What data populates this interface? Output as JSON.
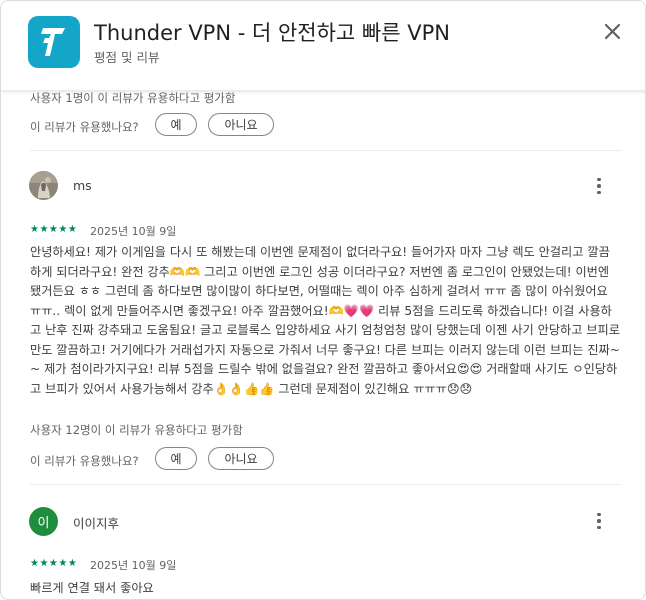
{
  "header": {
    "app_title": "Thunder VPN - 더 안전하고 빠른 VPN",
    "subtitle": "평점 및 리뷰",
    "icon": "thunder-vpn-logo",
    "icon_color": "#14a6c8"
  },
  "prev_review": {
    "helpful_count": "사용자 1명이 이 리뷰가 유용하다고 평가함",
    "helpful_question": "이 리뷰가 유용했나요?",
    "yes_label": "예",
    "no_label": "아니요"
  },
  "reviews": [
    {
      "author": "ms",
      "avatar": "photo-avatar",
      "stars": "★★★★★",
      "date": "2025년 10월 9일",
      "text": "안녕하세요! 제가 이게임을 다시 또 해봤는데 이번엔 문제점이 없더라구요! 들어가자 마자 그냥 렉도 안걸리고 깔끔하게 되더라구요! 완전 강추🫶🫶 그리고 이번엔 로그인 성공 이더라구요? 저번엔 좀 로그인이 안됐었는데! 이번엔 됐거든요 ㅎㅎ 그런데 좀 하다보면 많이많이 하다보면, 어떨때는 렉이 아주 심하게 걸려서 ㅠㅠ 좀 많이 아쉬웠어요 ㅠㅠ.. 렉이 없게 만들어주시면 좋겠구요! 아주 깔끔했어요!🫶💗💗 리뷰 5점을 드리도록 하겠습니다! 이걸 사용하고 난후 진짜 강추돼고 도움됨요! 글고 로블록스 입양하세요 사기 엄청엄청 많이 당했는데 이젠 사기 안당하고 브피로만도 깔끔하고! 거기에다가 거래섭가지 자동으로 가줘서 너무 좋구요! 다른 브피는 이러지 않는데 이런 브피는 진짜~~ 제가 첨이라가지구요! 리뷰 5점을 드릴수 밖에 없을걸요? 완전 깔끔하고 좋아서요😍😍 거래할때 사기도 ㅇ인당하고 브피가 있어서 사용가능해서 강추👌👌👍👍 그런데 문제점이 있긴해요 ㅠㅠㅠ😞😞",
      "helpful_count": "사용자 12명이 이 리뷰가 유용하다고 평가함",
      "helpful_question": "이 리뷰가 유용했나요?",
      "yes_label": "예",
      "no_label": "아니요"
    },
    {
      "author": "이이지후",
      "avatar_letter": "이",
      "avatar_color": "#1e8e3e",
      "stars": "★★★★★",
      "date": "2025년 10월 9일",
      "text": "빠르게 연결 돼서 좋아요"
    }
  ],
  "accent_color": "#01875f"
}
